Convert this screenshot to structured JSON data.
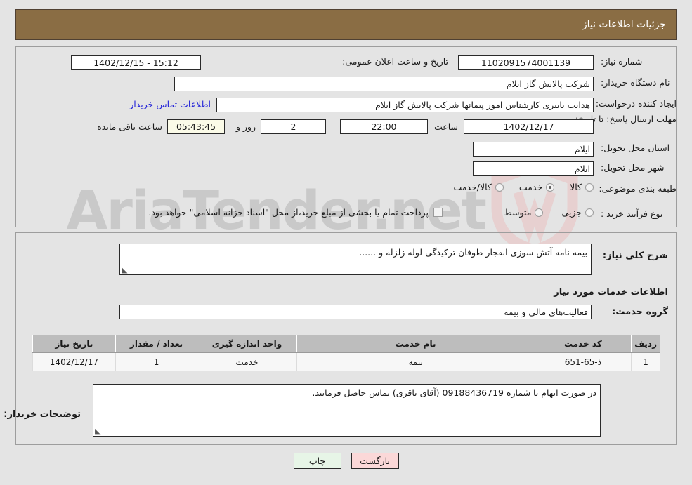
{
  "header": {
    "title": "جزئیات اطلاعات نیاز"
  },
  "watermark": {
    "text": "AriaTender.net",
    "icon": "shield-logo"
  },
  "form": {
    "need_number": {
      "label": "شماره نیاز:",
      "value": "1102091574001139"
    },
    "announce_datetime": {
      "label": "تاریخ و ساعت اعلان عمومی:",
      "value": "15:12 - 1402/12/15"
    },
    "buyer_org": {
      "label": "نام دستگاه خریدار:",
      "value": "شرکت پالایش گاز ایلام"
    },
    "buyer_org_secondary": {
      "value": "شرکت پالایش گاز ایلام"
    },
    "requester": {
      "label": "ایجاد کننده درخواست:",
      "value": "هدایت بابیری کارشناس امور پیمانها شرکت پالایش گاز ایلام"
    },
    "buyer_contact_link": {
      "label": "اطلاعات تماس خریدار"
    },
    "deadline": {
      "label": "مهلت ارسال پاسخ: تا تاریخ:",
      "date": "1402/12/17",
      "time_label": "ساعت",
      "time": "22:00",
      "days": "2",
      "days_label": "روز و",
      "remaining": "05:43:45",
      "remaining_label": "ساعت باقی مانده"
    },
    "province": {
      "label": "استان محل تحویل:",
      "value": "ایلام"
    },
    "city": {
      "label": "شهر محل تحویل:",
      "value": "ایلام"
    },
    "category": {
      "label": "طبقه بندی موضوعی:",
      "options": [
        {
          "label": "کالا",
          "selected": false
        },
        {
          "label": "خدمت",
          "selected": true
        },
        {
          "label": "کالا/خدمت",
          "selected": false
        }
      ]
    },
    "process_type": {
      "label": "نوع فرآیند خرید :",
      "options": [
        {
          "label": "جزیی",
          "selected": false
        },
        {
          "label": "متوسط",
          "selected": false
        }
      ],
      "checkbox": {
        "label": "پرداخت تمام یا بخشی از مبلغ خرید،از محل \"اسناد خزانه اسلامی\" خواهد بود.",
        "checked": false
      }
    }
  },
  "middle": {
    "summary": {
      "label": "شرح کلی نیاز:",
      "value": "بیمه نامه آتش سوزی انفجار طوفان ترکیدگی لوله زلزله و ......"
    },
    "services_heading": "اطلاعات خدمات مورد نیاز",
    "service_group": {
      "label": "گروه خدمت:",
      "value": "فعالیت‌های مالی و بیمه"
    },
    "buyer_notes": {
      "label": "توضیحات خریدار:",
      "value": "در صورت ابهام با شماره 09188436719 (آقای باقری) تماس حاصل فرمایید."
    }
  },
  "table": {
    "columns": [
      "ردیف",
      "کد خدمت",
      "نام خدمت",
      "واحد اندازه گیری",
      "تعداد / مقدار",
      "تاریخ نیاز"
    ],
    "rows": [
      {
        "row": "1",
        "code": "ذ-65-651",
        "name": "بیمه",
        "unit": "خدمت",
        "qty": "1",
        "date": "1402/12/17"
      }
    ]
  },
  "buttons": {
    "print": "چاپ",
    "back": "بازگشت"
  },
  "colors": {
    "header_bg": "#8a6d44",
    "page_bg": "#e4e4e4",
    "link": "#2323d8",
    "timer_bg": "#fbfbe8",
    "print_bg": "#e7f5e7",
    "back_bg": "#fbd8d8",
    "grid_header_bg": "#bdbdbd"
  }
}
